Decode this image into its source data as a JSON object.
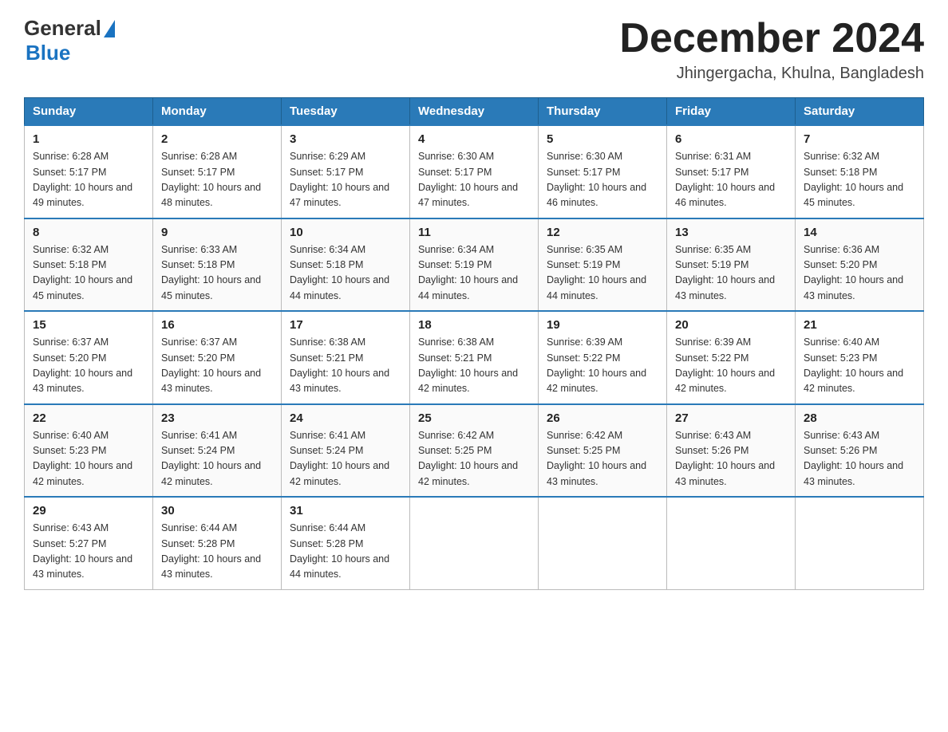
{
  "header": {
    "logo_general": "General",
    "logo_blue": "Blue",
    "month_title": "December 2024",
    "subtitle": "Jhingergacha, Khulna, Bangladesh"
  },
  "weekdays": [
    "Sunday",
    "Monday",
    "Tuesday",
    "Wednesday",
    "Thursday",
    "Friday",
    "Saturday"
  ],
  "weeks": [
    [
      {
        "day": "1",
        "sunrise": "6:28 AM",
        "sunset": "5:17 PM",
        "daylight": "10 hours and 49 minutes."
      },
      {
        "day": "2",
        "sunrise": "6:28 AM",
        "sunset": "5:17 PM",
        "daylight": "10 hours and 48 minutes."
      },
      {
        "day": "3",
        "sunrise": "6:29 AM",
        "sunset": "5:17 PM",
        "daylight": "10 hours and 47 minutes."
      },
      {
        "day": "4",
        "sunrise": "6:30 AM",
        "sunset": "5:17 PM",
        "daylight": "10 hours and 47 minutes."
      },
      {
        "day": "5",
        "sunrise": "6:30 AM",
        "sunset": "5:17 PM",
        "daylight": "10 hours and 46 minutes."
      },
      {
        "day": "6",
        "sunrise": "6:31 AM",
        "sunset": "5:17 PM",
        "daylight": "10 hours and 46 minutes."
      },
      {
        "day": "7",
        "sunrise": "6:32 AM",
        "sunset": "5:18 PM",
        "daylight": "10 hours and 45 minutes."
      }
    ],
    [
      {
        "day": "8",
        "sunrise": "6:32 AM",
        "sunset": "5:18 PM",
        "daylight": "10 hours and 45 minutes."
      },
      {
        "day": "9",
        "sunrise": "6:33 AM",
        "sunset": "5:18 PM",
        "daylight": "10 hours and 45 minutes."
      },
      {
        "day": "10",
        "sunrise": "6:34 AM",
        "sunset": "5:18 PM",
        "daylight": "10 hours and 44 minutes."
      },
      {
        "day": "11",
        "sunrise": "6:34 AM",
        "sunset": "5:19 PM",
        "daylight": "10 hours and 44 minutes."
      },
      {
        "day": "12",
        "sunrise": "6:35 AM",
        "sunset": "5:19 PM",
        "daylight": "10 hours and 44 minutes."
      },
      {
        "day": "13",
        "sunrise": "6:35 AM",
        "sunset": "5:19 PM",
        "daylight": "10 hours and 43 minutes."
      },
      {
        "day": "14",
        "sunrise": "6:36 AM",
        "sunset": "5:20 PM",
        "daylight": "10 hours and 43 minutes."
      }
    ],
    [
      {
        "day": "15",
        "sunrise": "6:37 AM",
        "sunset": "5:20 PM",
        "daylight": "10 hours and 43 minutes."
      },
      {
        "day": "16",
        "sunrise": "6:37 AM",
        "sunset": "5:20 PM",
        "daylight": "10 hours and 43 minutes."
      },
      {
        "day": "17",
        "sunrise": "6:38 AM",
        "sunset": "5:21 PM",
        "daylight": "10 hours and 43 minutes."
      },
      {
        "day": "18",
        "sunrise": "6:38 AM",
        "sunset": "5:21 PM",
        "daylight": "10 hours and 42 minutes."
      },
      {
        "day": "19",
        "sunrise": "6:39 AM",
        "sunset": "5:22 PM",
        "daylight": "10 hours and 42 minutes."
      },
      {
        "day": "20",
        "sunrise": "6:39 AM",
        "sunset": "5:22 PM",
        "daylight": "10 hours and 42 minutes."
      },
      {
        "day": "21",
        "sunrise": "6:40 AM",
        "sunset": "5:23 PM",
        "daylight": "10 hours and 42 minutes."
      }
    ],
    [
      {
        "day": "22",
        "sunrise": "6:40 AM",
        "sunset": "5:23 PM",
        "daylight": "10 hours and 42 minutes."
      },
      {
        "day": "23",
        "sunrise": "6:41 AM",
        "sunset": "5:24 PM",
        "daylight": "10 hours and 42 minutes."
      },
      {
        "day": "24",
        "sunrise": "6:41 AM",
        "sunset": "5:24 PM",
        "daylight": "10 hours and 42 minutes."
      },
      {
        "day": "25",
        "sunrise": "6:42 AM",
        "sunset": "5:25 PM",
        "daylight": "10 hours and 42 minutes."
      },
      {
        "day": "26",
        "sunrise": "6:42 AM",
        "sunset": "5:25 PM",
        "daylight": "10 hours and 43 minutes."
      },
      {
        "day": "27",
        "sunrise": "6:43 AM",
        "sunset": "5:26 PM",
        "daylight": "10 hours and 43 minutes."
      },
      {
        "day": "28",
        "sunrise": "6:43 AM",
        "sunset": "5:26 PM",
        "daylight": "10 hours and 43 minutes."
      }
    ],
    [
      {
        "day": "29",
        "sunrise": "6:43 AM",
        "sunset": "5:27 PM",
        "daylight": "10 hours and 43 minutes."
      },
      {
        "day": "30",
        "sunrise": "6:44 AM",
        "sunset": "5:28 PM",
        "daylight": "10 hours and 43 minutes."
      },
      {
        "day": "31",
        "sunrise": "6:44 AM",
        "sunset": "5:28 PM",
        "daylight": "10 hours and 44 minutes."
      },
      null,
      null,
      null,
      null
    ]
  ],
  "labels": {
    "sunrise_prefix": "Sunrise: ",
    "sunset_prefix": "Sunset: ",
    "daylight_prefix": "Daylight: "
  }
}
